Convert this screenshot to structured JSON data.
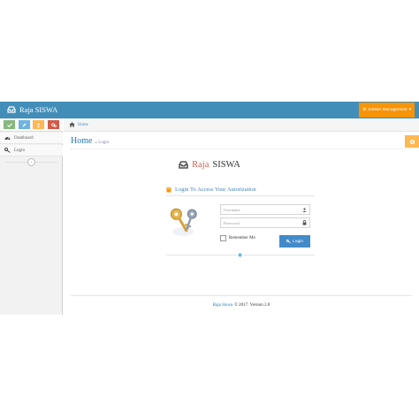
{
  "navbar": {
    "brand": "Raja SISWA",
    "user_menu": "SISWA Management",
    "colors": {
      "navbar_bg": "#438eb9",
      "user_menu_bg": "#f89406"
    }
  },
  "sidebar": {
    "shortcuts": [
      {
        "icon": "check-icon",
        "color": "#87b87f"
      },
      {
        "icon": "pencil-icon",
        "color": "#6fb3e0"
      },
      {
        "icon": "users-icon",
        "color": "#ffb752"
      },
      {
        "icon": "cogs-icon",
        "color": "#d15b47"
      }
    ],
    "items": [
      {
        "label": "Dashboard",
        "icon": "dashboard-icon"
      },
      {
        "label": "Login",
        "icon": "key-icon"
      }
    ]
  },
  "breadcrumb": {
    "home": "Home"
  },
  "page_header": {
    "title": "Home",
    "subtitle": "» Login"
  },
  "login": {
    "app_name_left": "Raja",
    "app_name_right": "SISWA",
    "heading": "Login To Access Your Autorization",
    "username_placeholder": "Username",
    "password_placeholder": "Password",
    "remember_label": "Remember Me",
    "button_label": "Login"
  },
  "footer": {
    "link_text": "Raja Siswa",
    "text": "© 2017. Version 2.0"
  }
}
